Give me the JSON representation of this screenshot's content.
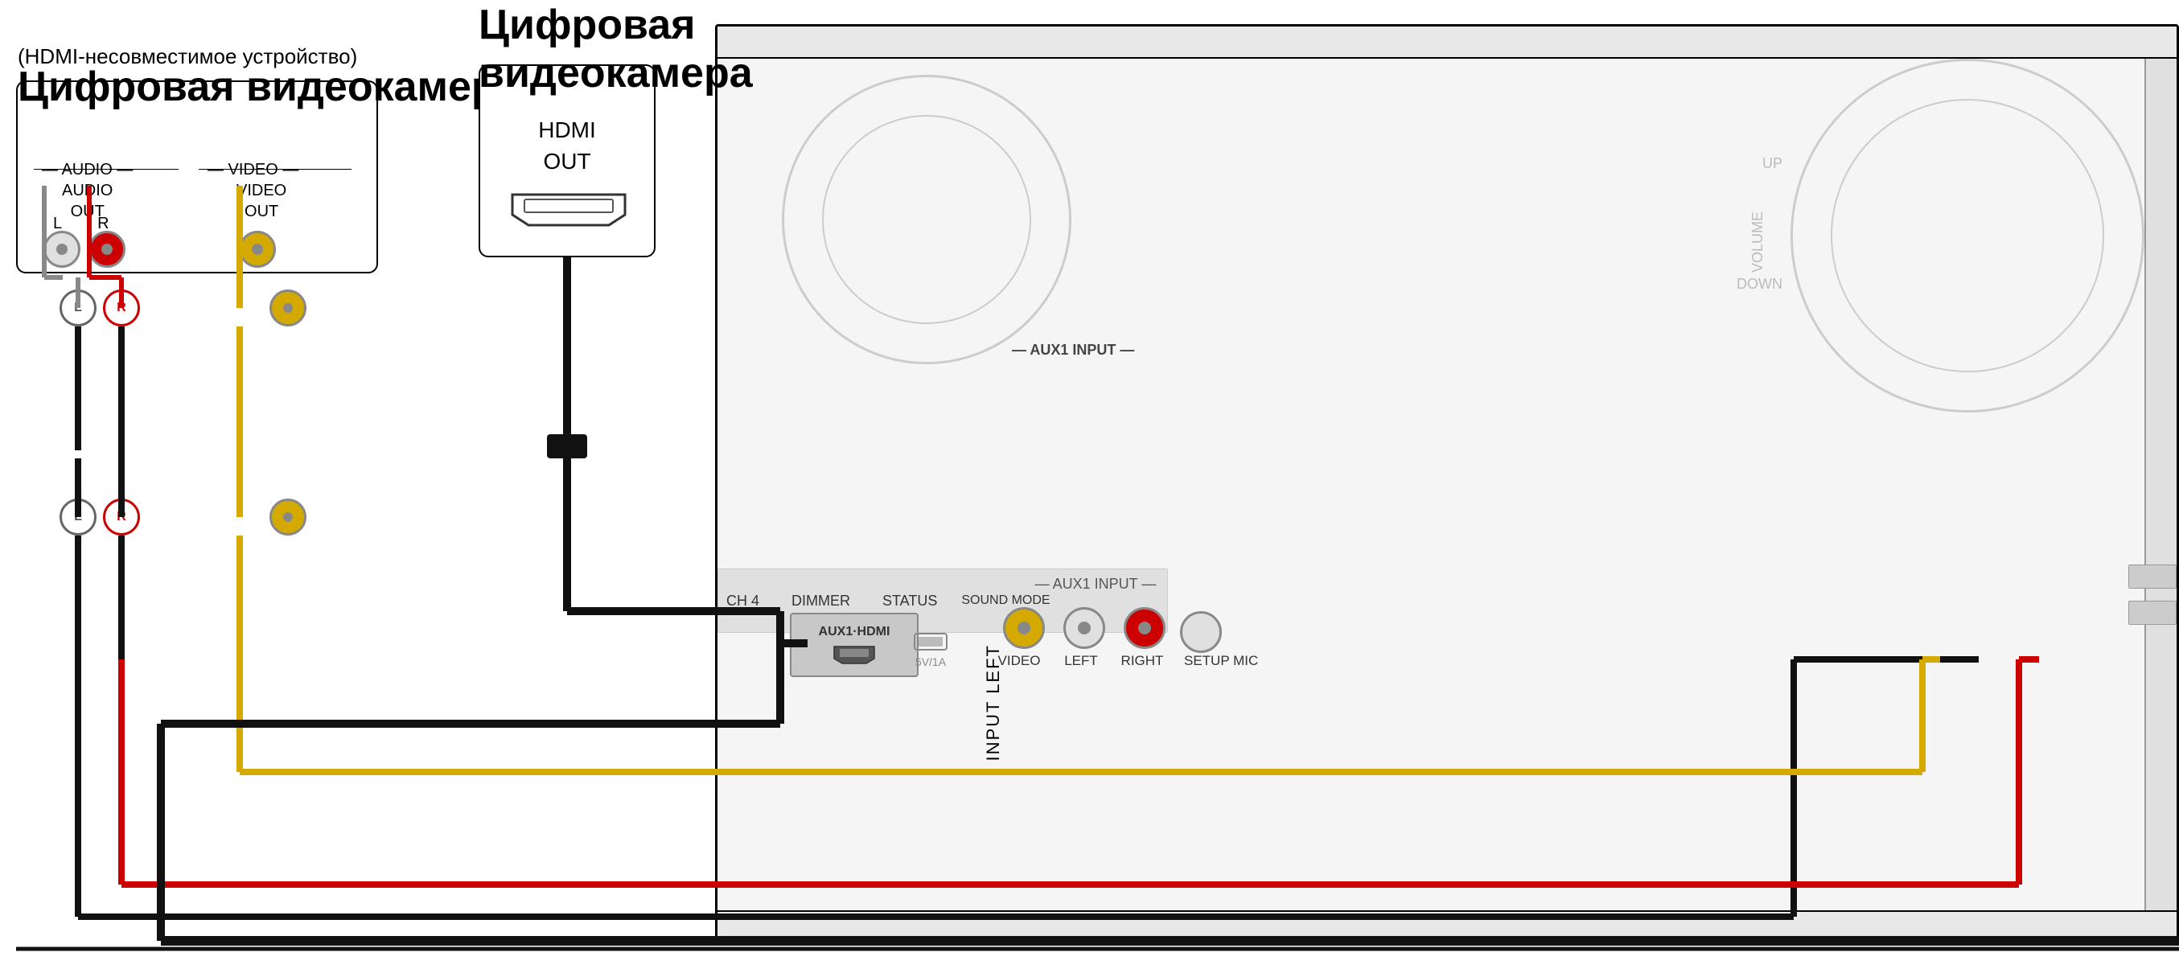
{
  "labels": {
    "analog_camera_subtitle": "(HDMI-несовместимое устройство)",
    "analog_camera_title": "Цифровая видеокамера",
    "digital_camera_title": "Цифровая\nвидеокамера",
    "audio_section": "— AUDIO —",
    "video_section": "— VIDEO —",
    "audio_out": "AUDIO\nOUT",
    "video_out": "VIDEO\nOUT",
    "lr": "L   R",
    "hdmi_out": "HDMI\nOUT",
    "aux1_hdmi": "AUX1·HDMI",
    "aux1_input": "AUX1 INPUT",
    "video_label": "VIDEO",
    "left_label": "LEFT",
    "right_label": "RIGHT",
    "setup_mic": "SETUP MIC",
    "input_left": "INPUT LEFT",
    "up_label": "UP",
    "down_label": "DOWN",
    "volume_label": "VOLUME",
    "dimmer_label": "DIMMER",
    "status_label": "STATUS",
    "sound_mode": "SOUND\nMODE",
    "ch4": "CH 4",
    "usb_label": "5V/1A",
    "plug_L": "L",
    "plug_R": "R"
  },
  "colors": {
    "white_rca": "#e0e0e0",
    "red_rca": "#cc0000",
    "yellow_rca": "#d4aa00",
    "black_cable": "#111111",
    "device_bg": "#f5f5f5",
    "panel_bg": "#d0d0d0",
    "connector_border": "#888888"
  }
}
